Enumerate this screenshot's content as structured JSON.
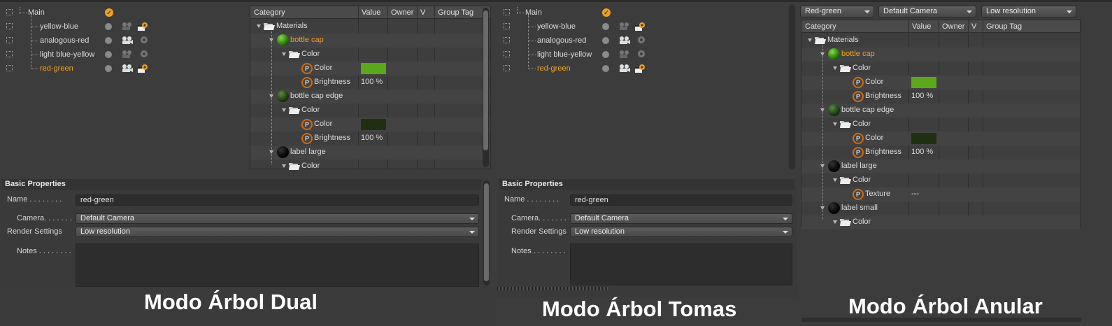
{
  "takes": {
    "root": "Main",
    "items": [
      "yellow-blue",
      "analogous-red",
      "light blue-yellow",
      "red-green"
    ],
    "active_index": 3
  },
  "table": {
    "headers": [
      "Category",
      "Value",
      "Owner",
      "V",
      "Group Tag"
    ],
    "rows": [
      {
        "label": "Materials",
        "type": "folder"
      },
      {
        "label": "bottle cap",
        "type": "material",
        "active": true
      },
      {
        "label": "Color",
        "type": "folder"
      },
      {
        "label": "Color",
        "type": "param",
        "value_color": "#5ca81a"
      },
      {
        "label": "Brightness",
        "type": "param",
        "value": "100 %"
      },
      {
        "label": "bottle cap edge",
        "type": "material"
      },
      {
        "label": "Color",
        "type": "folder"
      },
      {
        "label": "Color",
        "type": "param",
        "value_color": "#1f3012"
      },
      {
        "label": "Brightness",
        "type": "param",
        "value": "100 %"
      },
      {
        "label": "label large",
        "type": "material"
      },
      {
        "label": "Color",
        "type": "folder"
      },
      {
        "label": "Texture",
        "type": "param",
        "value": "---"
      },
      {
        "label": "label small",
        "type": "material"
      },
      {
        "label": "Color",
        "type": "folder"
      }
    ],
    "param_icon_letter": "P"
  },
  "basic_properties": {
    "title": "Basic Properties",
    "name_label": "Name . . . . . . . .",
    "name_value": "red-green",
    "camera_label": "Camera. . . . . . .",
    "camera_value": "Default Camera",
    "render_label": "Render Settings",
    "render_value": "Low resolution",
    "notes_label": "Notes . . . . . . . ."
  },
  "ring_mode": {
    "take_select": "Red-green",
    "camera_select": "Default Camera",
    "render_select": "Low resolution"
  },
  "captions": {
    "dual": "Modo Árbol Dual",
    "takes": "Modo Árbol Tomas",
    "ring": "Modo Árbol Anular"
  },
  "colors": {
    "accent": "#f0a020",
    "bright_green": "#5ca81a",
    "dark_green": "#1f3012"
  },
  "icons": [
    "folder-icon",
    "material-ball-icon",
    "param-p-icon",
    "camera-icon",
    "gear-icon",
    "check-icon",
    "expand-arrow-icon"
  ]
}
